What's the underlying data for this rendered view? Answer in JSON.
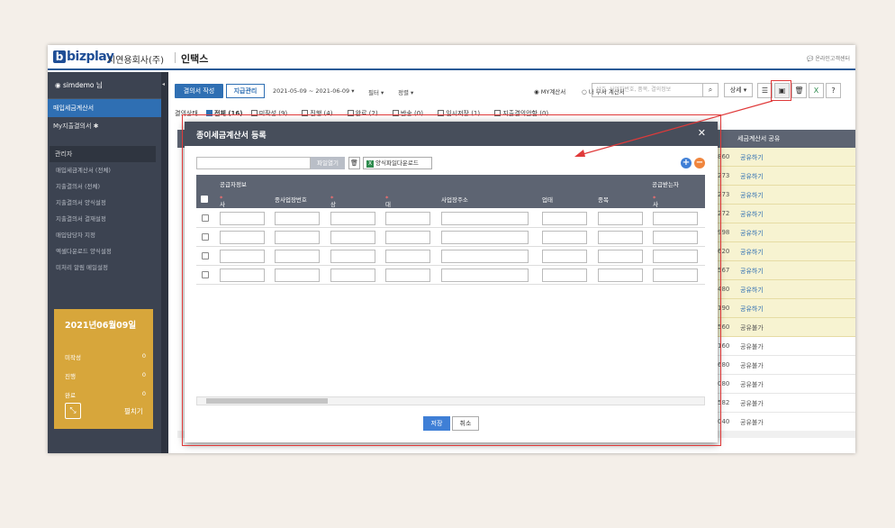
{
  "header": {
    "logo_text": "bizplay",
    "company": "시연용회사(주)",
    "app": "인택스",
    "customer_center": "온라인고객센터"
  },
  "sidebar": {
    "user": "simdemo 님",
    "items": [
      "매입세금계산서",
      "My지출결의서"
    ],
    "admin_label": "관리자",
    "sub_items": [
      "매입세금계산서 (전체)",
      "지출결의서 (전체)",
      "지출결의서 양식설정",
      "지출결의서 결재설정",
      "매입담당자 지정",
      "엑셀다운로드 양식설정",
      "미처리 알림 메일설정"
    ],
    "card": {
      "date": "2021년06월09일",
      "rows": [
        {
          "label": "미작성",
          "value": "0"
        },
        {
          "label": "진행",
          "value": "0"
        },
        {
          "label": "완료",
          "value": "0"
        }
      ],
      "unfold": "펼치기"
    }
  },
  "toolbar": {
    "write": "결의서 작성",
    "pay": "지급관리",
    "date_range": "2021-05-09 ~ 2021-06-09 ▾",
    "filter": "필터 ▾",
    "sort": "정렬 ▾",
    "radio_my": "MY계산서",
    "radio_dept": "내 부서 계산서",
    "search_placeholder": "상호, 사업자번호, 품목, 결의정보",
    "detail": "상세 ▾"
  },
  "status": {
    "label": "결의상태",
    "items": [
      "전체 (16)",
      "미작성 (9)",
      "진행 (4)",
      "완료 (2)",
      "반송 (0)",
      "임시저장 (1)",
      "지출결의안함 (0)"
    ]
  },
  "grid": {
    "col_share": "세금계산서 공유",
    "rows": [
      {
        "num": "860",
        "share": "공유하기"
      },
      {
        "num": "273",
        "share": "공유하기"
      },
      {
        "num": "273",
        "share": "공유하기"
      },
      {
        "num": "272",
        "share": "공유하기"
      },
      {
        "num": "998",
        "share": "공유하기"
      },
      {
        "num": "620",
        "share": "공유하기"
      },
      {
        "num": "567",
        "share": "공유하기"
      },
      {
        "num": "480",
        "share": "공유하기"
      },
      {
        "num": "190",
        "share": "공유하기"
      },
      {
        "num": "560",
        "share": "공유불가"
      },
      {
        "num": "160",
        "share": "공유불가"
      },
      {
        "num": "680",
        "share": "공유불가"
      },
      {
        "num": "080",
        "share": "공유불가"
      },
      {
        "num": "582",
        "share": "공유불가"
      },
      {
        "num": "040",
        "share": "공유불가"
      }
    ]
  },
  "modal": {
    "title": "종이세금계산서 등록",
    "file_open": "파일열기",
    "template_download": "양식파일다운로드",
    "group_supplier": "공급자정보",
    "group_receiver": "공급받는자",
    "columns": [
      "사업자번호",
      "종사업장번호",
      "상호(법인명)",
      "대표자성명",
      "사업장주소",
      "업태",
      "종목",
      "사업자번호"
    ],
    "save": "저장",
    "cancel": "취소"
  }
}
